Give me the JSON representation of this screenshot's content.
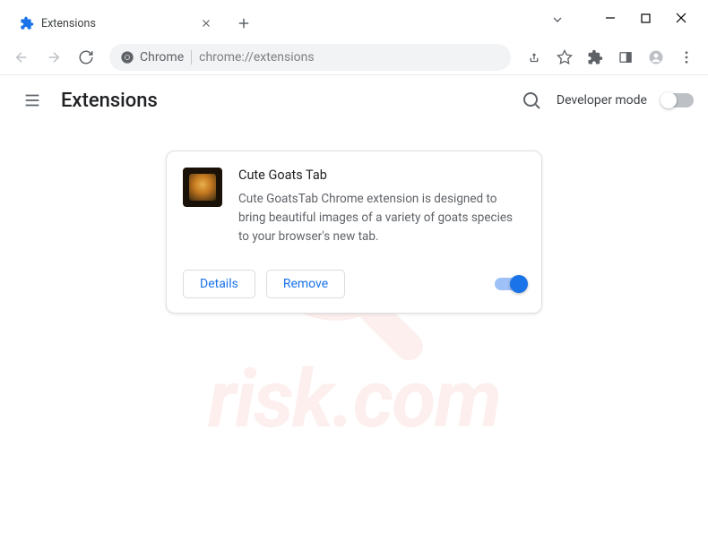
{
  "tab": {
    "title": "Extensions"
  },
  "omnibox": {
    "chip": "Chrome",
    "url": "chrome://extensions"
  },
  "header": {
    "title": "Extensions",
    "dev_mode_label": "Developer mode"
  },
  "extension": {
    "name": "Cute Goats Tab",
    "description": "Cute GoatsTab Chrome extension is designed to bring beautiful images of a variety of goats species to your browser's new tab.",
    "details_label": "Details",
    "remove_label": "Remove",
    "enabled": true
  },
  "watermark": {
    "text": "risk.com"
  }
}
